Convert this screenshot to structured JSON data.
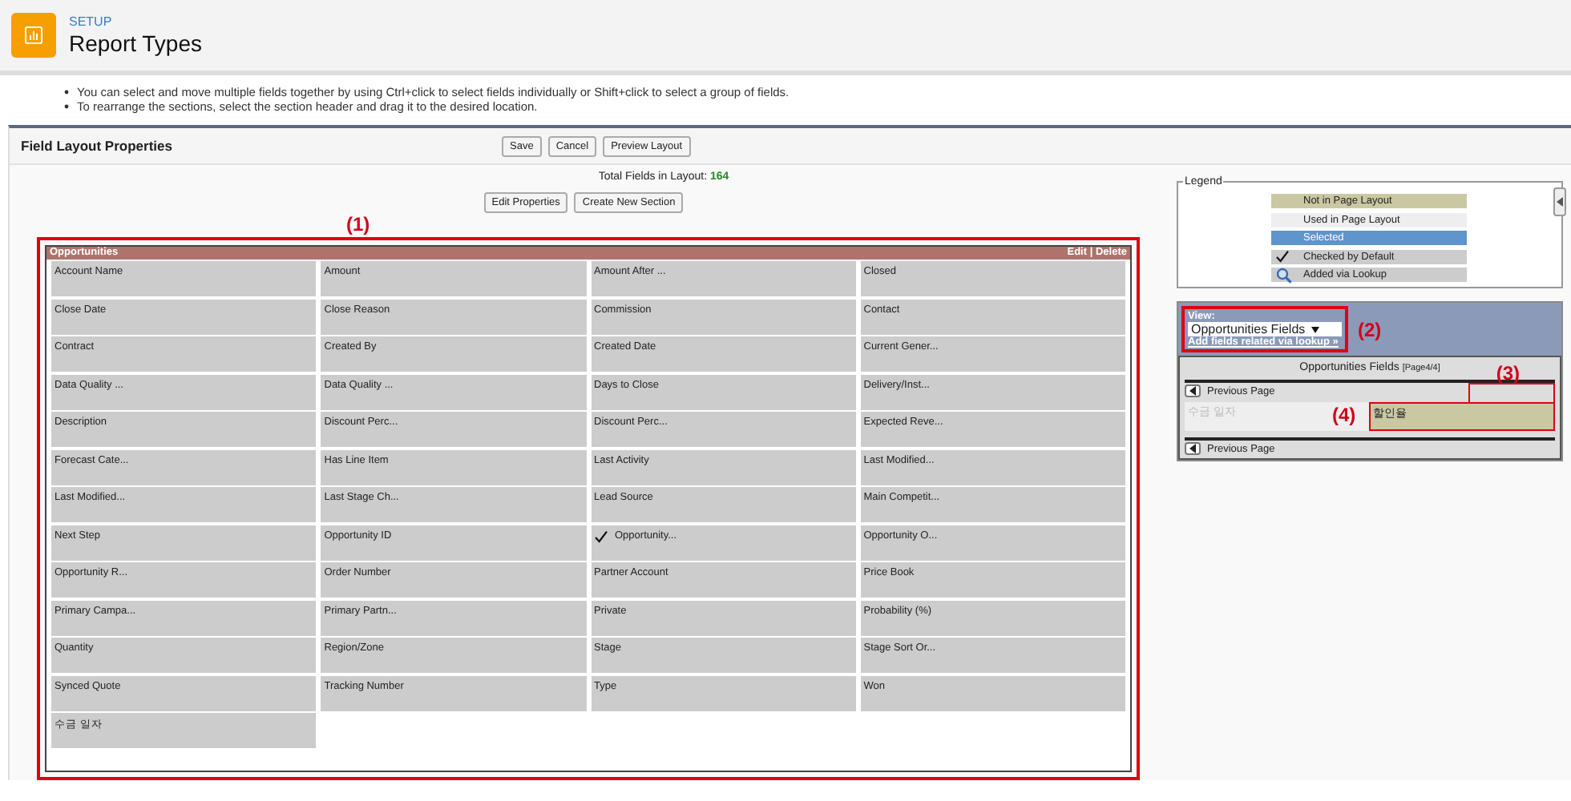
{
  "header": {
    "eyebrow": "SETUP",
    "title": "Report Types"
  },
  "instructions": [
    "You can select and move multiple fields together by using Ctrl+click to select fields individually or Shift+click to select a group of fields.",
    "To rearrange the sections, select the section header and drag it to the desired location."
  ],
  "toolbar": {
    "title": "Field Layout Properties",
    "buttons": [
      "Save",
      "Cancel",
      "Preview Layout"
    ]
  },
  "total": {
    "label": "Total Fields in Layout:",
    "value": "164"
  },
  "section_buttons": [
    "Edit Properties",
    "Create New Section"
  ],
  "section": {
    "annotation": "(1)",
    "title": "Opportunities",
    "edit": "Edit",
    "separator": "|",
    "delete": "Delete",
    "fields": [
      {
        "label": "Account Name",
        "checked": false
      },
      {
        "label": "Amount",
        "checked": false
      },
      {
        "label": "Amount After ...",
        "checked": false
      },
      {
        "label": "Closed",
        "checked": false
      },
      {
        "label": "Close Date",
        "checked": false
      },
      {
        "label": "Close Reason",
        "checked": false
      },
      {
        "label": "Commission",
        "checked": false
      },
      {
        "label": "Contact",
        "checked": false
      },
      {
        "label": "Contract",
        "checked": false
      },
      {
        "label": "Created By",
        "checked": false
      },
      {
        "label": "Created Date",
        "checked": false
      },
      {
        "label": "Current Gener...",
        "checked": false
      },
      {
        "label": "Data Quality ...",
        "checked": false
      },
      {
        "label": "Data Quality ...",
        "checked": false
      },
      {
        "label": "Days to Close",
        "checked": false
      },
      {
        "label": "Delivery/Inst...",
        "checked": false
      },
      {
        "label": "Description",
        "checked": false
      },
      {
        "label": "Discount Perc...",
        "checked": false
      },
      {
        "label": "Discount Perc...",
        "checked": false
      },
      {
        "label": "Expected Reve...",
        "checked": false
      },
      {
        "label": "Forecast Cate...",
        "checked": false
      },
      {
        "label": "Has Line Item",
        "checked": false
      },
      {
        "label": "Last Activity",
        "checked": false
      },
      {
        "label": "Last Modified...",
        "checked": false
      },
      {
        "label": "Last Modified...",
        "checked": false
      },
      {
        "label": "Last Stage Ch...",
        "checked": false
      },
      {
        "label": "Lead Source",
        "checked": false
      },
      {
        "label": "Main Competit...",
        "checked": false
      },
      {
        "label": "Next Step",
        "checked": false
      },
      {
        "label": "Opportunity ID",
        "checked": false
      },
      {
        "label": "Opportunity...",
        "checked": true
      },
      {
        "label": "Opportunity O...",
        "checked": false
      },
      {
        "label": "Opportunity R...",
        "checked": false
      },
      {
        "label": "Order Number",
        "checked": false
      },
      {
        "label": "Partner Account",
        "checked": false
      },
      {
        "label": "Price Book",
        "checked": false
      },
      {
        "label": "Primary Campa...",
        "checked": false
      },
      {
        "label": "Primary Partn...",
        "checked": false
      },
      {
        "label": "Private",
        "checked": false
      },
      {
        "label": "Probability (%)",
        "checked": false
      },
      {
        "label": "Quantity",
        "checked": false
      },
      {
        "label": "Region/Zone",
        "checked": false
      },
      {
        "label": "Stage",
        "checked": false
      },
      {
        "label": "Stage Sort Or...",
        "checked": false
      },
      {
        "label": "Synced Quote",
        "checked": false
      },
      {
        "label": "Tracking Number",
        "checked": false
      },
      {
        "label": "Type",
        "checked": false
      },
      {
        "label": "Won",
        "checked": false
      },
      {
        "label": "수금 일자",
        "checked": false
      }
    ]
  },
  "legend": {
    "title": "Legend",
    "items": [
      {
        "kind": "not_in_layout",
        "label": "Not in Page Layout"
      },
      {
        "kind": "used",
        "label": "Used in Page Layout"
      },
      {
        "kind": "selected",
        "label": "Selected"
      },
      {
        "kind": "checked",
        "label": "Checked by Default"
      },
      {
        "kind": "lookup",
        "label": "Added via Lookup"
      }
    ]
  },
  "view": {
    "annotation": "(2)",
    "label": "View:",
    "value": "Opportunities Fields",
    "link": "Add fields related via lookup »"
  },
  "palette": {
    "title": "Opportunities Fields",
    "page": "[Page4/4]",
    "prev": "Previous Page",
    "blank_annotation": "(3)",
    "field_annotation": "(4)",
    "fields": [
      {
        "kind": "used",
        "label": "수금 일자"
      },
      {
        "kind": "not_in_layout",
        "label": "할인율"
      }
    ],
    "prev_bottom": "Previous Page"
  }
}
